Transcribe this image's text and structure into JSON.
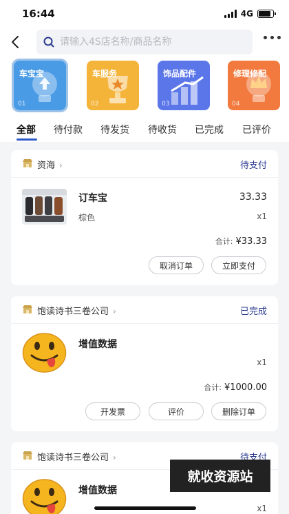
{
  "status_bar": {
    "time": "16:44",
    "network": "4G",
    "battery_level": 0.85
  },
  "search": {
    "placeholder": "请输入4S店名称/商品名称"
  },
  "categories": [
    {
      "label": "车宝宝",
      "num": "01",
      "color": "#4a9be6",
      "icon": "lightbulb-upload-icon",
      "active": true
    },
    {
      "label": "车服务",
      "num": "02",
      "color": "#f4b43a",
      "icon": "trophy-star-icon",
      "active": false
    },
    {
      "label": "饰品配件",
      "num": "03",
      "color": "#5b76e8",
      "icon": "bar-growth-icon",
      "active": false
    },
    {
      "label": "修理修配",
      "num": "04",
      "color": "#f27a3e",
      "icon": "lightbulb-crown-icon",
      "active": false
    }
  ],
  "tabs": [
    {
      "label": "全部",
      "active": true
    },
    {
      "label": "待付款",
      "active": false
    },
    {
      "label": "待发货",
      "active": false
    },
    {
      "label": "待收货",
      "active": false
    },
    {
      "label": "已完成",
      "active": false
    },
    {
      "label": "已评价",
      "active": false
    }
  ],
  "orders": [
    {
      "shop": "资海",
      "status": "待支付",
      "product": "订车宝",
      "spec": "棕色",
      "price": "33.33",
      "qty": "x1",
      "total_label": "合计:",
      "total": "¥33.33",
      "buttons": [
        "取消订单",
        "立即支付"
      ]
    },
    {
      "shop": "饱读诗书三卷公司",
      "status": "已完成",
      "product": "增值数据",
      "qty": "x1",
      "total_label": "合计:",
      "total": "¥1000.00",
      "buttons": [
        "开发票",
        "评价",
        "删除订单"
      ]
    },
    {
      "shop": "饱读诗书三卷公司",
      "status": "待支付",
      "product": "增值数据",
      "qty": "x1"
    }
  ],
  "watermark": "就收资源站"
}
